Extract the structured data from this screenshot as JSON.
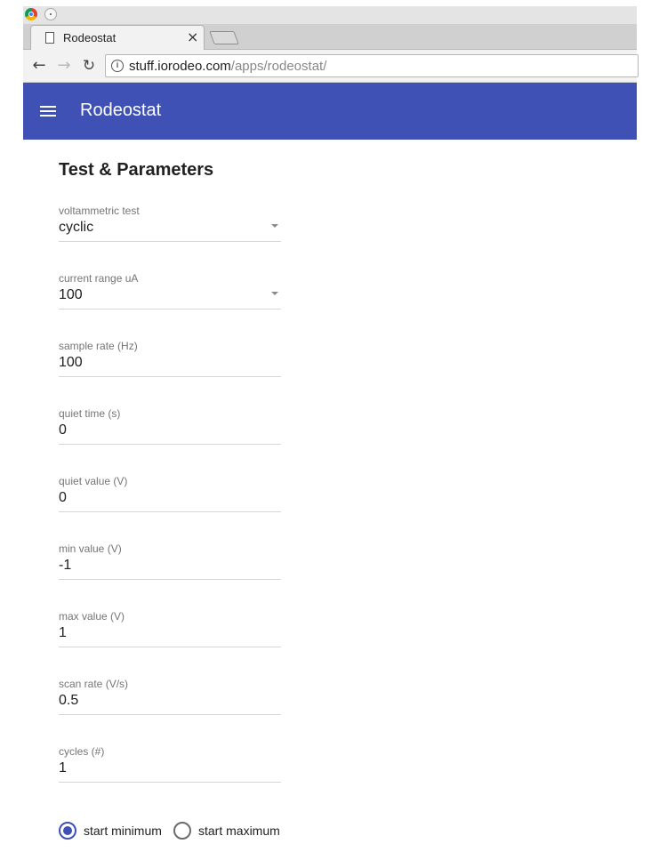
{
  "browser": {
    "tab_title": "Rodeostat",
    "tab_close": "×",
    "url_host": "stuff.iorodeo.com",
    "url_path": "/apps/rodeostat/"
  },
  "app": {
    "title": "Rodeostat",
    "accent_color": "#3f51b5"
  },
  "section": {
    "title": "Test & Parameters"
  },
  "fields": {
    "test": {
      "label": "voltammetric test",
      "value": "cyclic"
    },
    "current_range": {
      "label": "current range uA",
      "value": "100"
    },
    "sample_rate": {
      "label": "sample rate (Hz)",
      "value": "100"
    },
    "quiet_time": {
      "label": "quiet time (s)",
      "value": "0"
    },
    "quiet_value": {
      "label": "quiet value (V)",
      "value": "0"
    },
    "min_value": {
      "label": "min value (V)",
      "value": "-1"
    },
    "max_value": {
      "label": "max value (V)",
      "value": "1"
    },
    "scan_rate": {
      "label": "scan rate (V/s)",
      "value": "0.5"
    },
    "cycles": {
      "label": "cycles (#)",
      "value": "1"
    }
  },
  "start": {
    "minimum_label": "start minimum",
    "maximum_label": "start maximum",
    "selected": "minimum"
  }
}
